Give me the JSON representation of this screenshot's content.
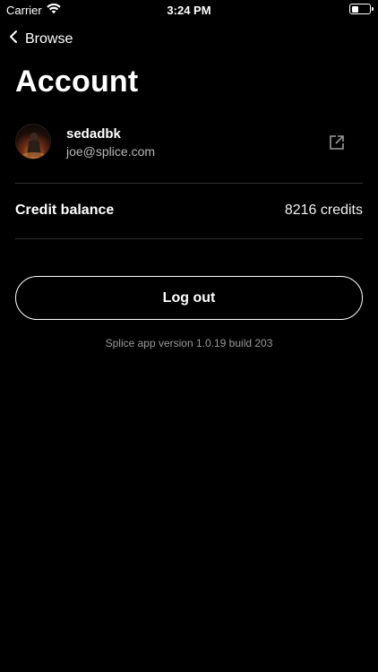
{
  "status_bar": {
    "carrier": "Carrier",
    "time": "3:24 PM",
    "icons": [
      "wifi-icon",
      "battery-icon"
    ]
  },
  "nav": {
    "back_label": "Browse",
    "back_icon": "chevron-left-icon"
  },
  "page": {
    "title": "Account"
  },
  "profile": {
    "username": "sedadbk",
    "email": "joe@splice.com",
    "avatar_icon": "avatar",
    "external_icon": "external-link-icon"
  },
  "credits": {
    "label": "Credit balance",
    "value": "8216 credits"
  },
  "actions": {
    "logout_label": "Log out"
  },
  "footer": {
    "version_text": "Splice app version 1.0.19 build 203"
  },
  "colors": {
    "background": "#000000",
    "text": "#ffffff",
    "secondary_text": "#b8b8b8",
    "divider": "#2e2e2e",
    "footer_text": "#9a9a9a"
  }
}
